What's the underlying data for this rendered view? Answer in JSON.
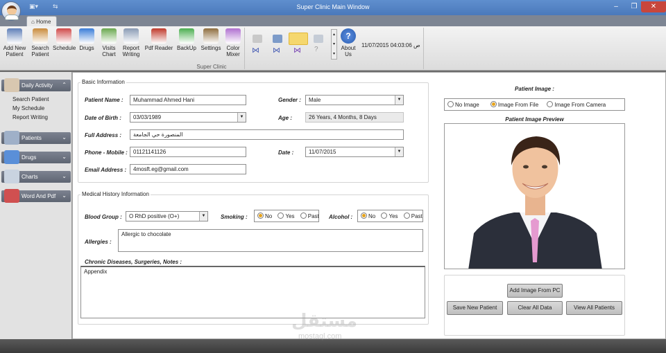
{
  "window": {
    "title": "Super Clinic Main Window",
    "minimize": "–",
    "restore": "❐",
    "close": "✕"
  },
  "qat": {
    "save": "▣▾",
    "extra": "⇆"
  },
  "ribbon": {
    "tab": "Home",
    "group_label": "Super Clinic",
    "buttons": [
      {
        "l1": "Add New",
        "l2": "Patient",
        "color": "#5f7fb8"
      },
      {
        "l1": "Search",
        "l2": "Patient",
        "color": "#c98b3c"
      },
      {
        "l1": "Schedule",
        "l2": "",
        "color": "#d04a4a"
      },
      {
        "l1": "Drugs",
        "l2": "",
        "color": "#3b7dd8"
      },
      {
        "l1": "Visits",
        "l2": "Chart",
        "color": "#6aa84f"
      },
      {
        "l1": "Report",
        "l2": "Writing",
        "color": "#8a9bb5"
      },
      {
        "l1": "Pdf Reader",
        "l2": "",
        "color": "#c0392b"
      },
      {
        "l1": "BackUp",
        "l2": "",
        "color": "#4caf50"
      },
      {
        "l1": "Settings",
        "l2": "",
        "color": "#8e6d3e"
      },
      {
        "l1": "Color",
        "l2": "Mixer",
        "color": "#b070d0"
      }
    ],
    "about": {
      "l1": "About",
      "l2": "Us"
    },
    "datetime": "11/07/2015 04:03:06 ص"
  },
  "sidebar": {
    "sections": [
      {
        "label": "Daily Activity",
        "chev": "⌃"
      },
      {
        "label": "Patients",
        "chev": "⌄"
      },
      {
        "label": "Drugs",
        "chev": "⌄"
      },
      {
        "label": "Charts",
        "chev": "⌄"
      },
      {
        "label": "Word And Pdf",
        "chev": "⌄"
      }
    ],
    "links": [
      "Search Patient",
      "My Schedule",
      "Report Writing"
    ]
  },
  "basic": {
    "title": "Basic Information",
    "name_label": "Patient Name :",
    "name": "Muhammad Ahmed Hani",
    "gender_label": "Gender :",
    "gender": "Male",
    "dob_label": "Date of Birth :",
    "dob": "03/03/1989",
    "age_label": "Age :",
    "age": "26 Years, 4 Months, 8 Days",
    "address_label": "Full Address :",
    "address": "المنصورة حي الجامعة",
    "phone_label": "Phone - Mobile :",
    "phone": "01121141126",
    "date_label": "Date :",
    "date": "11/07/2015",
    "email_label": "Email Address :",
    "email": "4mosft.eg@gmail.com"
  },
  "medical": {
    "title": "Medical History Information",
    "blood_label": "Blood Group :",
    "blood": "O RhD positive (O+)",
    "smoking_label": "Smoking :",
    "alcohol_label": "Alcohol :",
    "opt_no": "No",
    "opt_yes": "Yes",
    "opt_past": "Past",
    "allergies_label": "Allergies :",
    "allergies": "Allergic to chocolate",
    "chronic_label": "Chronic Diseases, Surgeries, Notes :",
    "chronic": "Appendix"
  },
  "image": {
    "title": "Patient Image :",
    "opt_none": "No Image",
    "opt_file": "Image From File",
    "opt_camera": "Image From Camera",
    "preview_label": "Patient Image Preview",
    "add_btn": "Add Image From PC",
    "save_btn": "Save New Patient",
    "clear_btn": "Clear All Data",
    "view_btn": "View All Patients"
  },
  "watermark": {
    "ar": "مستقل",
    "en": "mostaql.com"
  },
  "colors": {
    "titlebar": "#4a79bb",
    "radio_on": "#e5a21a",
    "nav_header": "#5e6572"
  }
}
